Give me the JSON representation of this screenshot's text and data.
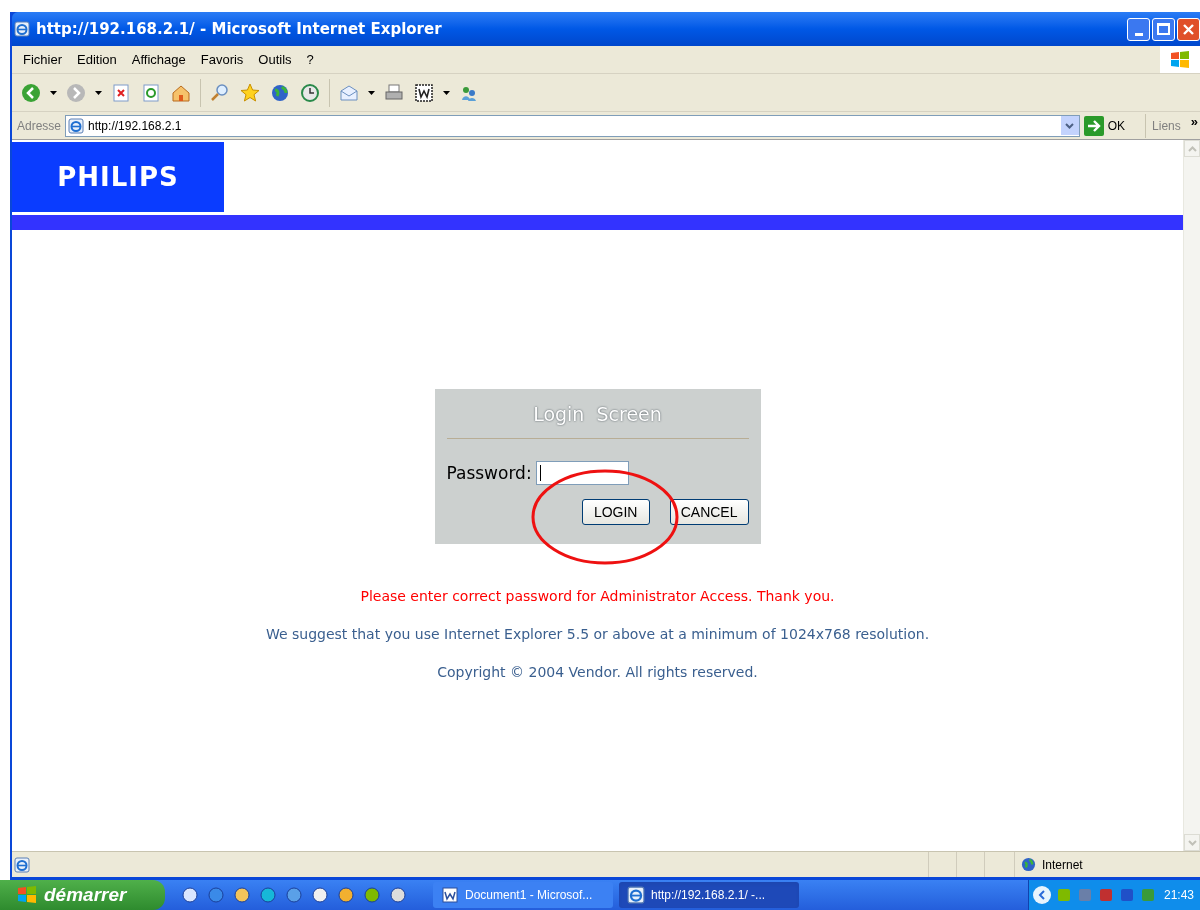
{
  "window": {
    "title": "http://192.168.2.1/ - Microsoft Internet Explorer"
  },
  "menu": [
    "Fichier",
    "Edition",
    "Affichage",
    "Favoris",
    "Outils",
    "?"
  ],
  "address_bar": {
    "label": "Adresse",
    "value": "http://192.168.2.1",
    "go_label": "OK",
    "links_label": "Liens",
    "more": "»"
  },
  "page": {
    "logo": "PHILIPS",
    "login": {
      "title": "Login  Screen",
      "password_label": "Password:",
      "buttons": [
        "LOGIN",
        "CANCEL"
      ]
    },
    "messages": [
      {
        "kind": "error",
        "text": "Please enter correct password for Administrator Access. Thank you."
      },
      {
        "kind": "info",
        "text": "We suggest that you use Internet Explorer 5.5 or above at a minimum of 1024x768 resolution."
      },
      {
        "kind": "info",
        "text": "Copyright © 2004 Vendor. All rights reserved."
      }
    ]
  },
  "status_bar": {
    "zone": "Internet"
  },
  "taskbar": {
    "start": "démarrer",
    "tasks": [
      {
        "label": "Document1 - Microsof...",
        "kind": "word",
        "selected": false
      },
      {
        "label": "http://192.168.2.1/ -...",
        "kind": "browser",
        "selected": true
      }
    ],
    "clock": "21:43"
  }
}
